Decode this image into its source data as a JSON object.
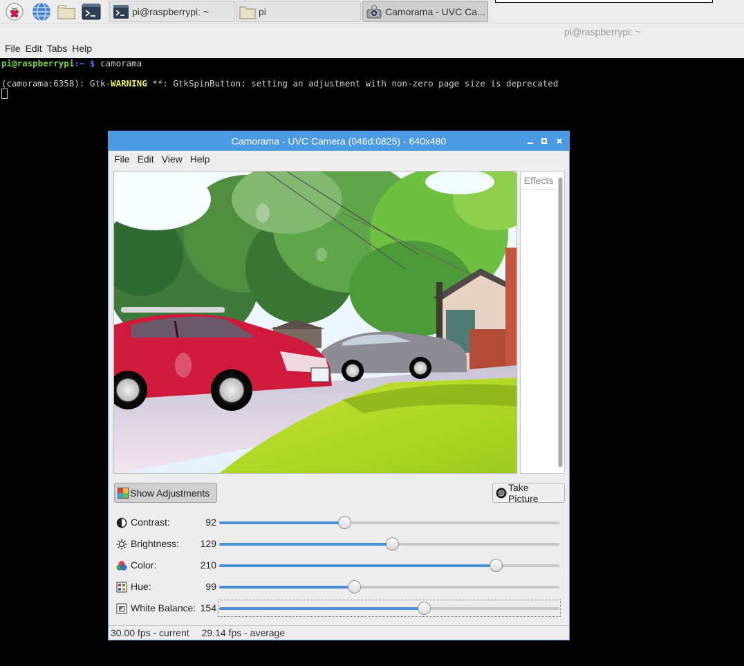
{
  "taskbar": {
    "tasks": [
      {
        "label": "pi@raspberrypi: ~"
      },
      {
        "label": "pi"
      },
      {
        "label": "Camorama - UVC Ca..."
      }
    ]
  },
  "terminal": {
    "title": "pi@raspberrypi: ~",
    "menu": [
      "File",
      "Edit",
      "Tabs",
      "Help"
    ],
    "prompt_user": "pi@raspberrypi",
    "prompt_path": ":~ $",
    "command": " camorama",
    "warn_prefix": "(camorama:6358): Gtk-",
    "warn_word": "WARNING",
    "warn_suffix": " **: GtkSpinButton: setting an adjustment with non-zero page size is deprecated"
  },
  "camorama": {
    "title": "Camorama - UVC Camera (046d:0825) - 640x480",
    "menu": [
      "File",
      "Edit",
      "View",
      "Help"
    ],
    "effects_label": "Effects",
    "show_adjustments": "Show Adjustments",
    "take_picture": "Take Picture",
    "sliders": [
      {
        "label": "Contrast:",
        "value": 92,
        "fraction": 0.368
      },
      {
        "label": "Brightness:",
        "value": 129,
        "fraction": 0.508
      },
      {
        "label": "Color:",
        "value": 210,
        "fraction": 0.812
      },
      {
        "label": "Hue:",
        "value": 99,
        "fraction": 0.396
      },
      {
        "label": "White Balance:",
        "value": 154,
        "fraction": 0.602
      }
    ],
    "status_current": "30.00 fps - current",
    "status_average": "29.14 fps - average"
  },
  "colors": {
    "accent": "#4d9ae4",
    "slider_fill": "#4a90d9"
  }
}
